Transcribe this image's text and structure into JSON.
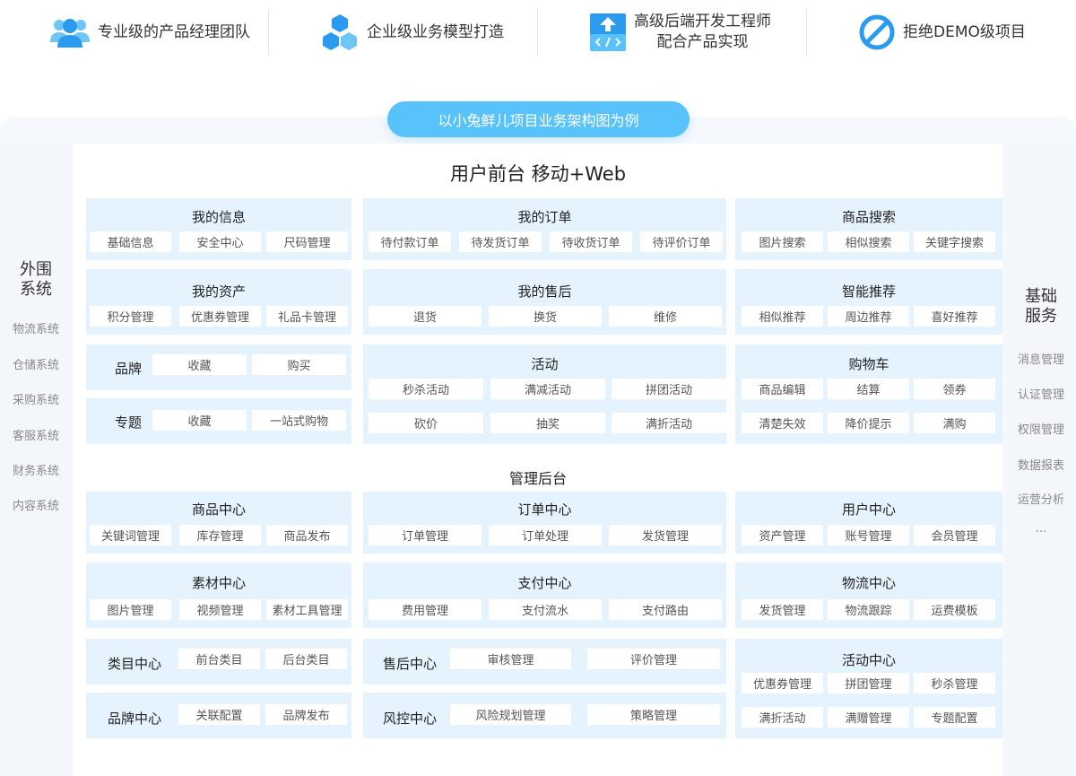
{
  "features": [
    {
      "text": "专业级的产品经理团队",
      "icon": "users-icon"
    },
    {
      "text": "企业级业务模型打造",
      "icon": "cubes-icon"
    },
    {
      "text_line1": "高级后端开发工程师",
      "text_line2": "配合产品实现",
      "icon": "code-upload-icon"
    },
    {
      "text": "拒绝DEMO级项目",
      "icon": "forbidden-icon"
    }
  ],
  "banner": "以小兔鲜儿项目业务架构图为例",
  "left_side": {
    "title_line1": "外围",
    "title_line2": "系统",
    "items": [
      "物流系统",
      "仓储系统",
      "采购系统",
      "客服系统",
      "财务系统",
      "内容系统"
    ]
  },
  "right_side": {
    "title_line1": "基础",
    "title_line2": "服务",
    "items": [
      "消息管理",
      "认证管理",
      "权限管理",
      "数据报表",
      "运营分析",
      "..."
    ]
  },
  "frontend_title": "用户前台 移动+Web",
  "backend_title": "管理后台",
  "frontend": {
    "my_info": {
      "title": "我的信息",
      "items": [
        "基础信息",
        "安全中心",
        "尺码管理"
      ]
    },
    "my_orders": {
      "title": "我的订单",
      "items": [
        "待付款订单",
        "待发货订单",
        "待收货订单",
        "待评价订单"
      ]
    },
    "search": {
      "title": "商品搜索",
      "items": [
        "图片搜索",
        "相似搜索",
        "关键字搜索"
      ]
    },
    "my_assets": {
      "title": "我的资产",
      "items": [
        "积分管理",
        "优惠券管理",
        "礼品卡管理"
      ]
    },
    "after_sale": {
      "title": "我的售后",
      "items": [
        "退货",
        "换货",
        "维修"
      ]
    },
    "recommend": {
      "title": "智能推荐",
      "items": [
        "相似推荐",
        "周边推荐",
        "喜好推荐"
      ]
    },
    "brand": {
      "title": "品牌",
      "items": [
        "收藏",
        "购买"
      ]
    },
    "topic": {
      "title": "专题",
      "items": [
        "收藏",
        "一站式购物"
      ]
    },
    "activity": {
      "title": "活动",
      "items": [
        "秒杀活动",
        "满减活动",
        "拼团活动",
        "砍价",
        "抽奖",
        "满折活动"
      ]
    },
    "cart": {
      "title": "购物车",
      "items": [
        "商品编辑",
        "结算",
        "领券",
        "清楚失效",
        "降价提示",
        "满购"
      ]
    }
  },
  "backend": {
    "product_center": {
      "title": "商品中心",
      "items": [
        "关键词管理",
        "库存管理",
        "商品发布"
      ]
    },
    "order_center": {
      "title": "订单中心",
      "items": [
        "订单管理",
        "订单处理",
        "发货管理"
      ]
    },
    "user_center": {
      "title": "用户中心",
      "items": [
        "资产管理",
        "账号管理",
        "会员管理"
      ]
    },
    "material_center": {
      "title": "素材中心",
      "items": [
        "图片管理",
        "视频管理",
        "素材工具管理"
      ]
    },
    "payment_center": {
      "title": "支付中心",
      "items": [
        "费用管理",
        "支付流水",
        "支付路由"
      ]
    },
    "logistics_center": {
      "title": "物流中心",
      "items": [
        "发货管理",
        "物流跟踪",
        "运费模板"
      ]
    },
    "category_center": {
      "title": "类目中心",
      "items": [
        "前台类目",
        "后台类目"
      ]
    },
    "aftersale_center": {
      "title": "售后中心",
      "items": [
        "审核管理",
        "评价管理"
      ]
    },
    "activity_center": {
      "title": "活动中心",
      "items": [
        "优惠券管理",
        "拼团管理",
        "秒杀管理",
        "满折活动",
        "满赠管理",
        "专题配置"
      ]
    },
    "brand_center": {
      "title": "品牌中心",
      "items": [
        "关联配置",
        "品牌发布"
      ]
    },
    "risk_center": {
      "title": "风控中心",
      "items": [
        "风险规划管理",
        "策略管理"
      ]
    }
  },
  "colors": {
    "accent": "#58c3fb",
    "icon_blue": "#2b9bf0",
    "box_bg": "#e5f3ff",
    "panel_bg": "#f5f8fd"
  }
}
